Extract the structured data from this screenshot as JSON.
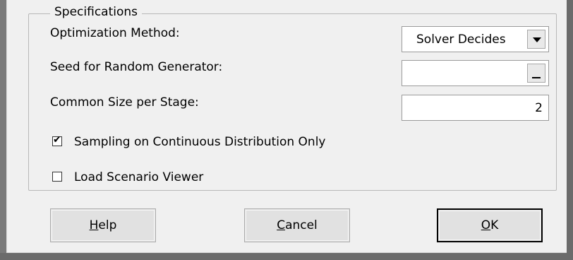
{
  "group": {
    "title": "Specifications"
  },
  "fields": {
    "optimization_method": {
      "label": "Optimization Method:",
      "value": "Solver Decides"
    },
    "seed": {
      "label": "Seed for Random Generator:",
      "value": ""
    },
    "common_size": {
      "label": "Common Size per Stage:",
      "value": "2"
    }
  },
  "checkboxes": {
    "sampling": {
      "label": "Sampling on Continuous Distribution Only",
      "checked": true,
      "mark": "✔"
    },
    "scenario_viewer": {
      "label": "Load Scenario Viewer",
      "checked": false,
      "mark": ""
    }
  },
  "buttons": {
    "help": {
      "mnemonic": "H",
      "rest": "elp"
    },
    "cancel": {
      "mnemonic": "C",
      "rest": "ancel"
    },
    "ok": {
      "mnemonic": "O",
      "rest": "K"
    }
  }
}
